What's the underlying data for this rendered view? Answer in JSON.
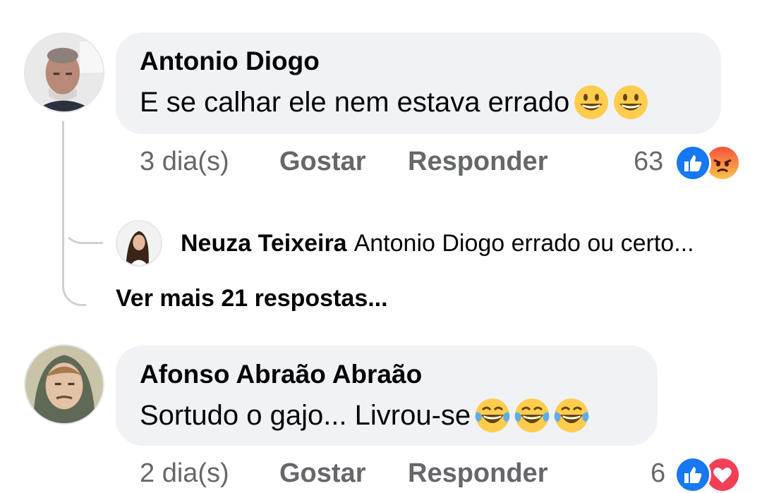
{
  "comments": [
    {
      "author": "Antonio Diogo",
      "text": "E se calhar ele nem estava errado",
      "emojis": [
        "grinning-face",
        "grinning-face"
      ],
      "time": "3 dia(s)",
      "like_label": "Gostar",
      "reply_label": "Responder",
      "reaction_count": "63",
      "reactions": [
        "like",
        "angry"
      ]
    },
    {
      "author": "Afonso Abraão Abraão",
      "text": "Sortudo o gajo... Livrou-se",
      "emojis": [
        "tears-of-joy-face",
        "tears-of-joy-face",
        "tears-of-joy-face"
      ],
      "time": "2 dia(s)",
      "like_label": "Gostar",
      "reply_label": "Responder",
      "reaction_count": "6",
      "reactions": [
        "like",
        "love"
      ]
    }
  ],
  "reply_preview": {
    "author": "Neuza Teixeira",
    "text": "Antonio Diogo errado ou certo..."
  },
  "more_replies_label": "Ver mais 21 respostas...",
  "colors": {
    "bubble": "#f0f2f5",
    "secondary_text": "#65676b",
    "like_blue": "#1877f2",
    "angry_orange": "#f5533d",
    "love_red": "#f33e58",
    "emoji_yellow": "#ffcc4d"
  }
}
